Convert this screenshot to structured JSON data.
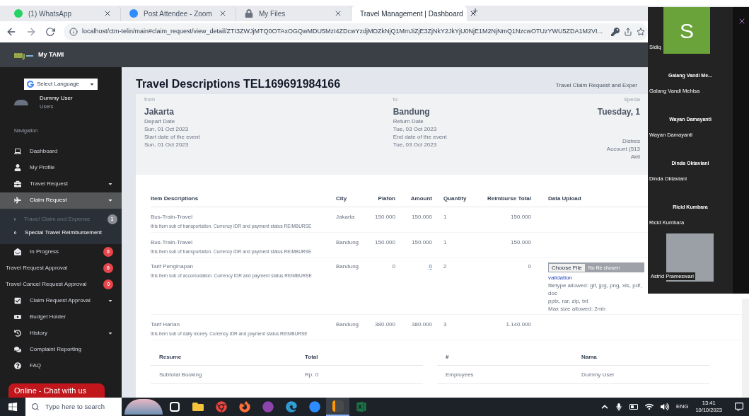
{
  "browser": {
    "tabs": [
      {
        "title": "(1) WhatsApp",
        "selected": false
      },
      {
        "title": "Post Attendee - Zoom",
        "selected": false
      },
      {
        "title": "My Files",
        "selected": false
      },
      {
        "title": "Travel Management | Dashboard",
        "selected": true
      }
    ],
    "new_tab": "+",
    "address": "localhost/ctm-telin/main#claim_request/view_detail/ZTI3ZWJjMTQ0OTAxOGQwMDU5MzI4ZDcwYzdjMDZkNjQ1MmJiZjE3ZjNkY2JkYjU0NjE1M2NjNmQ1NzcwOTUzYWU5ZDA1M2VI..."
  },
  "app": {
    "brand": "My TAMI"
  },
  "sidebar": {
    "language": "Select Language",
    "user": {
      "name": "Dummy User",
      "role": "Users"
    },
    "section": "Navigation",
    "items": [
      {
        "label": "Dashboard",
        "submenu": false,
        "selected": false
      },
      {
        "label": "My Profile",
        "submenu": false,
        "selected": false
      },
      {
        "label": "Travel Request",
        "submenu": true,
        "selected": false
      },
      {
        "label": "Claim Request",
        "submenu": true,
        "selected": true,
        "expanded": true,
        "children": [
          {
            "label": "Travel Claim and Expense",
            "selected": false,
            "badge": {
              "text": "1",
              "color": "#8a8f96"
            }
          },
          {
            "label": "Special Travel Reimbursement",
            "selected": true
          }
        ]
      },
      {
        "label": "In Progress",
        "submenu": false,
        "selected": false,
        "badge": {
          "text": "0",
          "color": "#e8464b"
        }
      },
      {
        "label": "Travel Request Approval",
        "submenu": false,
        "selected": false,
        "badge": {
          "text": "0",
          "color": "#e8464b"
        }
      },
      {
        "label": "Travel Cancel Request Approval",
        "submenu": false,
        "selected": false,
        "badge": {
          "text": "0",
          "color": "#e8464b"
        }
      },
      {
        "label": "Claim Request Approval",
        "submenu": true,
        "selected": false
      },
      {
        "label": "Budget Holder",
        "submenu": false,
        "selected": false
      },
      {
        "label": "History",
        "submenu": true,
        "selected": false
      },
      {
        "label": "Complaint Reporting",
        "submenu": false,
        "selected": false
      },
      {
        "label": "FAQ",
        "submenu": false,
        "selected": false
      }
    ]
  },
  "chat_button": "Online - Chat with us",
  "page": {
    "title": "Travel Descriptions TEL169691984166",
    "from": {
      "caption": "from",
      "city": "Jakarta",
      "lines": [
        "Depart Date",
        "Sun, 01 Oct 2023",
        "Start date of the event",
        "Sun, 01 Oct 2023"
      ]
    },
    "to": {
      "caption": "to",
      "city": "Bandung",
      "lines": [
        "Return Date",
        "Tue, 03 Oct 2023",
        "End date of the event",
        "Tue, 03 Oct 2023"
      ]
    },
    "right": {
      "heading": "Travel Claim Request and Exper",
      "caption": "Specia",
      "date": "Tuesday, 1",
      "lines": [
        "Distres",
        "Account (513",
        "Akti"
      ]
    },
    "items_table": {
      "columns": [
        "Item Descriptions",
        "City",
        "Plafon",
        "Amount",
        "Quantity",
        "Reimburse Total",
        "Data Upload"
      ],
      "rows": [
        {
          "name": "Bus-Train-Travel",
          "note": "this item sub of transportation. Currency IDR and payment status REIMBURSE",
          "city": "Jakarta",
          "plafon": "150.000",
          "amount": "150.000",
          "amount_editable": false,
          "quantity": "1",
          "total": "150.000"
        },
        {
          "name": "Bus-Train-Travel",
          "note": "this item sub of transportation. Currency IDR and payment status REIMBURSE",
          "city": "Bandung",
          "plafon": "150.000",
          "amount": "150.000",
          "amount_editable": false,
          "quantity": "1",
          "total": "150.000"
        },
        {
          "name": "Tarif Penginapan",
          "note": "this item sub of accomodation. Currency IDR and payment status REIMBURSE",
          "city": "Bandung",
          "plafon": "0",
          "amount": "0",
          "amount_editable": true,
          "quantity": "2",
          "total": "0",
          "upload": {
            "button": "Choose File",
            "value": "No file chosen",
            "link": "validation",
            "lines": [
              "filetype allowed: gif, jpg, png, xls, pdf, doc",
              "pptx, rar, zip, txt",
              "Max size allowed: 2mb"
            ]
          }
        },
        {
          "name": "Tarif Harian",
          "note": "this item sub of daily money. Currency IDR and payment status REIMBURSE",
          "city": "Bandung",
          "plafon": "380.000",
          "amount": "380.000",
          "amount_editable": false,
          "quantity": "3",
          "total": "1.140.000"
        }
      ]
    },
    "resume_table": {
      "columns": [
        "Resume",
        "Total"
      ],
      "rows": [
        [
          "Subtotal Booking",
          "Rp. 0"
        ]
      ]
    },
    "people_table": {
      "columns": [
        "#",
        "Nama"
      ],
      "rows": [
        [
          "Employees",
          "Dummy User"
        ]
      ]
    }
  },
  "meeting_panel": {
    "self": {
      "initial": "S",
      "name": "Sidiq"
    },
    "participants": [
      {
        "title": "Galang Vandi Me...",
        "name": "Galang Vandi Mehisa",
        "video": false
      },
      {
        "title": "Wayan Damayanti",
        "name": "Wayan Damayanti",
        "video": false
      },
      {
        "title": "Dinda Oktaviani",
        "name": "Dinda Oktaviani",
        "video": false
      },
      {
        "title": "Ricid Kumbara",
        "name": "Ricid Kumbara",
        "video": false
      },
      {
        "name": "Astrid Prameswari",
        "video": true
      }
    ]
  },
  "taskbar": {
    "search_placeholder": "Type here to search",
    "apps": [
      {
        "selected": false
      },
      {
        "selected": false
      },
      {
        "selected": false
      },
      {
        "selected": false
      },
      {
        "selected": false
      },
      {
        "selected": false
      },
      {
        "selected": false
      },
      {
        "selected": true
      },
      {
        "selected": false
      }
    ],
    "language": "ENG",
    "time": "13:41",
    "date": "10/10/2023"
  }
}
